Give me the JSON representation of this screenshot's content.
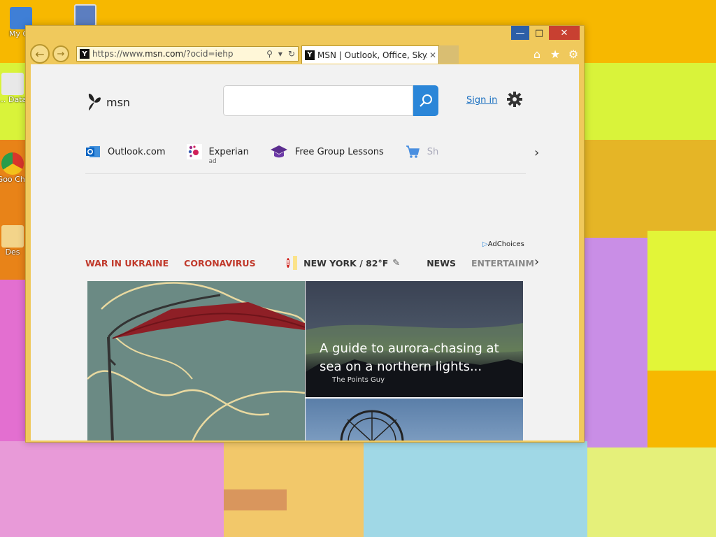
{
  "desktop": {
    "icons": [
      {
        "label": "My Co"
      },
      {
        "label": "M… Data…"
      },
      {
        "label": "Goo Chr"
      },
      {
        "label": "Des"
      }
    ]
  },
  "browser": {
    "address_url_prefix": "https://www.",
    "address_url_domain": "msn.com",
    "address_url_suffix": "/?ocid=iehp",
    "tab_title": "MSN | Outlook, Office, Sky...",
    "favicon_letter": "Y"
  },
  "page": {
    "logo_text": "msn",
    "search": {
      "placeholder": ""
    },
    "signin_label": "Sign in",
    "quick_links": [
      {
        "label": "Outlook.com",
        "icon": "outlook-icon"
      },
      {
        "label": "Experian",
        "sub": "ad",
        "icon": "experian-icon"
      },
      {
        "label": "Free Group Lessons",
        "icon": "graduation-cap-icon"
      },
      {
        "label": "Sh",
        "icon": "cart-icon"
      }
    ],
    "adchoices": "AdChoices",
    "topics": {
      "war": "WAR IN UKRAINE",
      "corona": "CORONAVIRUS",
      "weather": "NEW YORK / 82°F",
      "news": "NEWS",
      "entertainment": "ENTERTAINM"
    },
    "cards": {
      "right_top": {
        "headline": "A guide to aurora-chasing at sea on a northern lights...",
        "source": "The Points Guy"
      }
    }
  },
  "colors": {
    "accent_blue": "#2b86d8",
    "topic_red": "#c0392b",
    "window_frame": "#f0c95c"
  }
}
